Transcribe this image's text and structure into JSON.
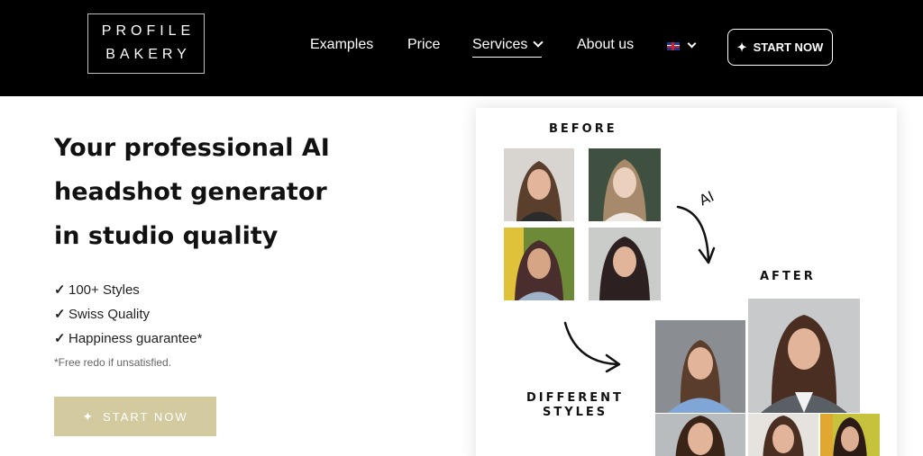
{
  "brand": {
    "line1": "PROFILE",
    "line2": "BAKERY"
  },
  "nav": {
    "links": [
      "Examples",
      "Price",
      "Services",
      "About us"
    ],
    "language_icon": "uk-flag-icon",
    "cta_label": "START NOW",
    "cta_icon": "magic-wand-icon"
  },
  "hero": {
    "title_lines": [
      "Your professional AI",
      "headshot generator",
      "in studio quality"
    ],
    "features": [
      "100+ Styles",
      "Swiss Quality",
      "Happiness guarantee*"
    ],
    "check_icon": "checkmark-icon",
    "note": "*Free redo if unsatisfied.",
    "cta_label": "START NOW",
    "cta_color": "#d4caa0"
  },
  "showcase": {
    "before_label": "BEFORE",
    "ai_label": "AI",
    "after_label": "AFTER",
    "styles_line1": "DIFFERENT",
    "styles_line2": "STYLES"
  },
  "colors": {
    "nav_bg": "#000000",
    "accent": "#d4caa0"
  }
}
